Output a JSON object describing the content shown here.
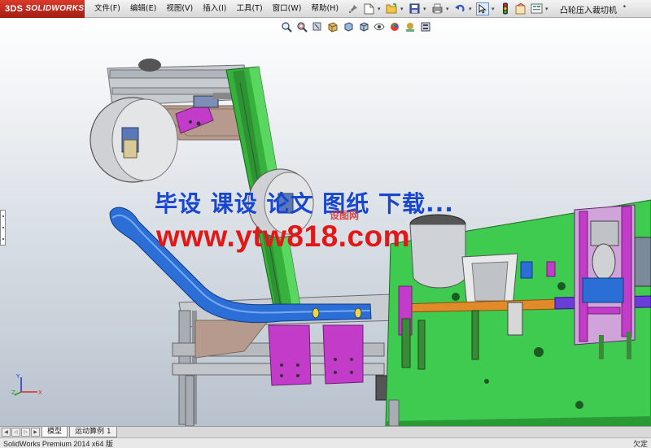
{
  "app": {
    "brand_prefix": "3DS",
    "brand_name": "SOLIDWORKS",
    "document_title": "凸轮压入裁切机",
    "document_title_arrow": "•"
  },
  "menu": {
    "items": [
      {
        "label": "文件(F)"
      },
      {
        "label": "编辑(E)"
      },
      {
        "label": "视图(V)"
      },
      {
        "label": "插入(I)"
      },
      {
        "label": "工具(T)"
      },
      {
        "label": "窗口(W)"
      },
      {
        "label": "帮助(H)"
      }
    ]
  },
  "toolbar_icons": [
    "pin-icon",
    "new-document-icon",
    "open-folder-icon",
    "save-icon",
    "print-icon",
    "undo-icon",
    "select-cursor-icon",
    "rebuild-traffic-light-icon",
    "file-properties-icon",
    "options-icon"
  ],
  "heads_up_icons": [
    "zoom-to-fit-icon",
    "zoom-to-area-icon",
    "previous-view-icon",
    "section-view-icon",
    "view-orientation-icon",
    "display-style-icon",
    "hide-show-items-icon",
    "edit-appearance-icon",
    "apply-scene-icon",
    "view-settings-icon"
  ],
  "watermark": {
    "line1": "毕设 课设 论文 图纸 下载...",
    "line2": "www.ytw818.com",
    "small": "设图网"
  },
  "triad": {
    "x": "X",
    "y": "Y",
    "z": "Z"
  },
  "tabs": {
    "model": "模型",
    "motion_study": "运动算例 1"
  },
  "status": {
    "left": "SolidWorks Premium 2014 x64 版",
    "right": "欠定"
  },
  "colors": {
    "brand_red": "#c8281b",
    "watermark_blue": "#1746d0",
    "watermark_red": "#e01818",
    "plate_green": "#3ecb4f",
    "column_green": "#36b23c",
    "chute_blue": "#2b6fd6",
    "bracket_magenta": "#c23cc9",
    "frame_gray": "#a9aeb4"
  }
}
